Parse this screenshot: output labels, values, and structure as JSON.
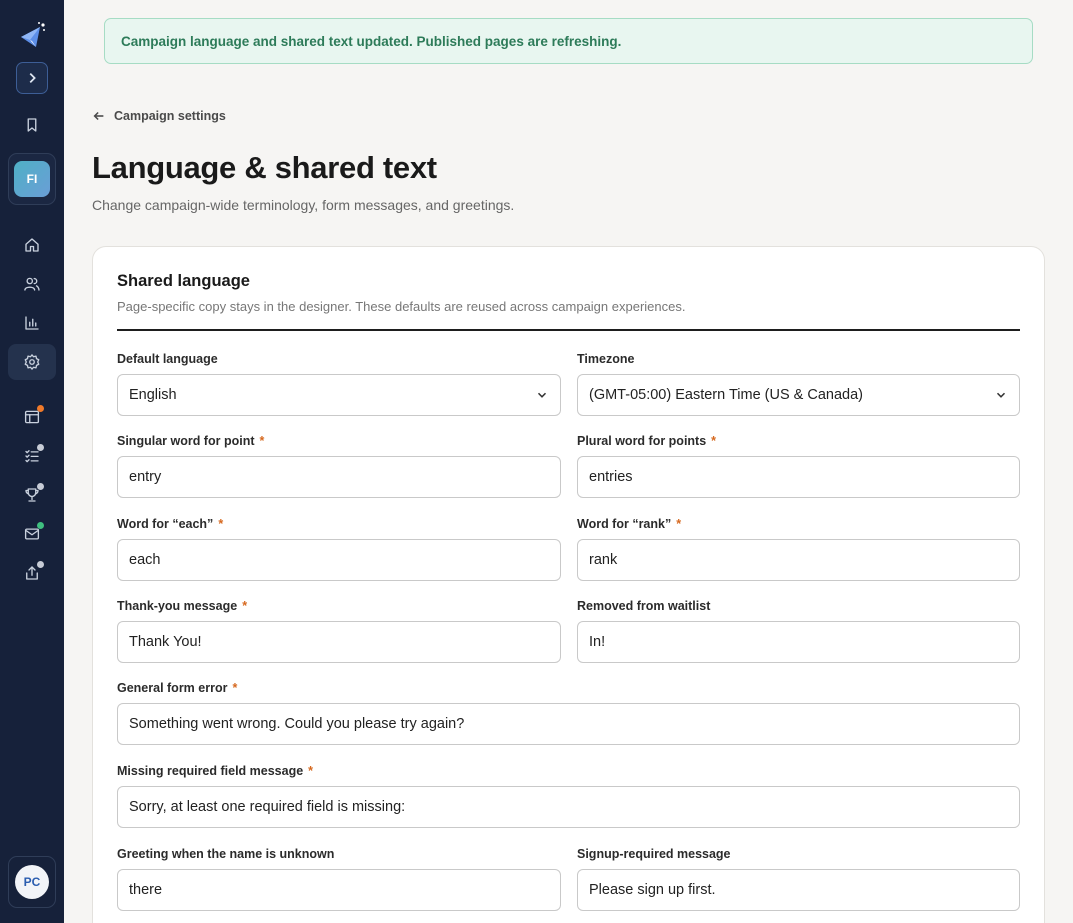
{
  "banner": {
    "text": "Campaign language and shared text updated. Published pages are refreshing."
  },
  "nav": {
    "back_label": "Campaign settings",
    "workspace_initials": "FI",
    "user_initials": "PC",
    "icons": [
      "home-icon",
      "users-icon",
      "chart-icon",
      "settings-icon",
      "layout-icon",
      "checklist-icon",
      "trophy-icon",
      "mail-icon",
      "export-icon"
    ],
    "indicator_colors": {
      "orange": "#f07a2a",
      "grey": "#c7ccd6",
      "green": "#3fbf7f"
    }
  },
  "page": {
    "title": "Language & shared text",
    "subtitle": "Change campaign-wide terminology, form messages, and greetings."
  },
  "section": {
    "title": "Shared language",
    "subtitle": "Page-specific copy stays in the designer. These defaults are reused across campaign experiences."
  },
  "fields": {
    "default_language": {
      "label": "Default language",
      "value": "English"
    },
    "timezone": {
      "label": "Timezone",
      "value": "(GMT-05:00) Eastern Time (US & Canada)"
    },
    "singular_point": {
      "label": "Singular word for point",
      "value": "entry",
      "required": "*"
    },
    "plural_points": {
      "label": "Plural word for points",
      "value": "entries",
      "required": "*"
    },
    "word_each": {
      "label": "Word for “each”",
      "value": "each",
      "required": "*"
    },
    "word_rank": {
      "label": "Word for “rank”",
      "value": "rank",
      "required": "*"
    },
    "thank_you": {
      "label": "Thank-you message",
      "value": "Thank You!",
      "required": "*"
    },
    "removed_waitlist": {
      "label": "Removed from waitlist",
      "value": "In!"
    },
    "general_error": {
      "label": "General form error",
      "value": "Something went wrong. Could you please try again?",
      "required": "*"
    },
    "missing_required": {
      "label": "Missing required field message",
      "value": "Sorry, at least one required field is missing:",
      "required": "*"
    },
    "greeting_unknown": {
      "label": "Greeting when the name is unknown",
      "value": "there"
    },
    "signup_required": {
      "label": "Signup-required message",
      "value": "Please sign up first."
    }
  }
}
